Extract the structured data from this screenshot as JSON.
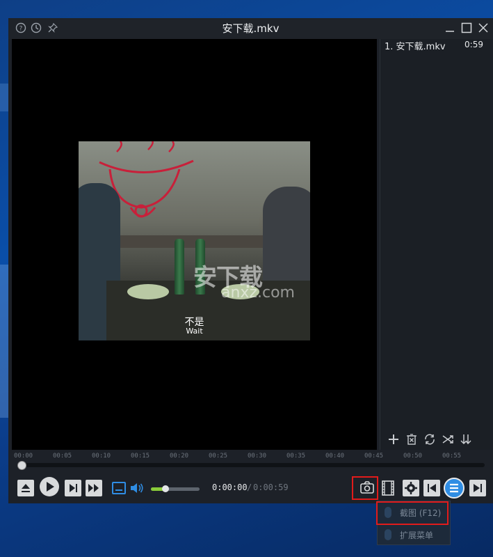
{
  "window": {
    "title": "安下载.mkv",
    "accent": "#2f8de4",
    "close_color": "#e21b1b"
  },
  "titlebar_icons": [
    "help-icon",
    "history-icon",
    "pin-icon"
  ],
  "video": {
    "subtitle_cn": "不是",
    "subtitle_en": "Wait",
    "watermark_cn": "安下载",
    "watermark_en": "anxz.com"
  },
  "playlist": {
    "items": [
      {
        "label": "1. 安下载.mkv",
        "duration": "0:59"
      }
    ],
    "tools": [
      "add-icon",
      "delete-icon",
      "loop-icon",
      "shuffle-icon",
      "sort-icon"
    ]
  },
  "timeline": {
    "ticks": [
      "00:00",
      "00:05",
      "00:10",
      "00:15",
      "00:20",
      "00:25",
      "00:30",
      "00:35",
      "00:40",
      "00:45",
      "00:50",
      "00:55"
    ],
    "progress": 0.0
  },
  "controls": {
    "current_time": "0:00:00",
    "separator": "/",
    "total_time": "0:00:59",
    "volume": 0.3
  },
  "context_menu": {
    "items": [
      {
        "label": "截图 (F12)"
      },
      {
        "label": "扩展菜单"
      }
    ]
  }
}
